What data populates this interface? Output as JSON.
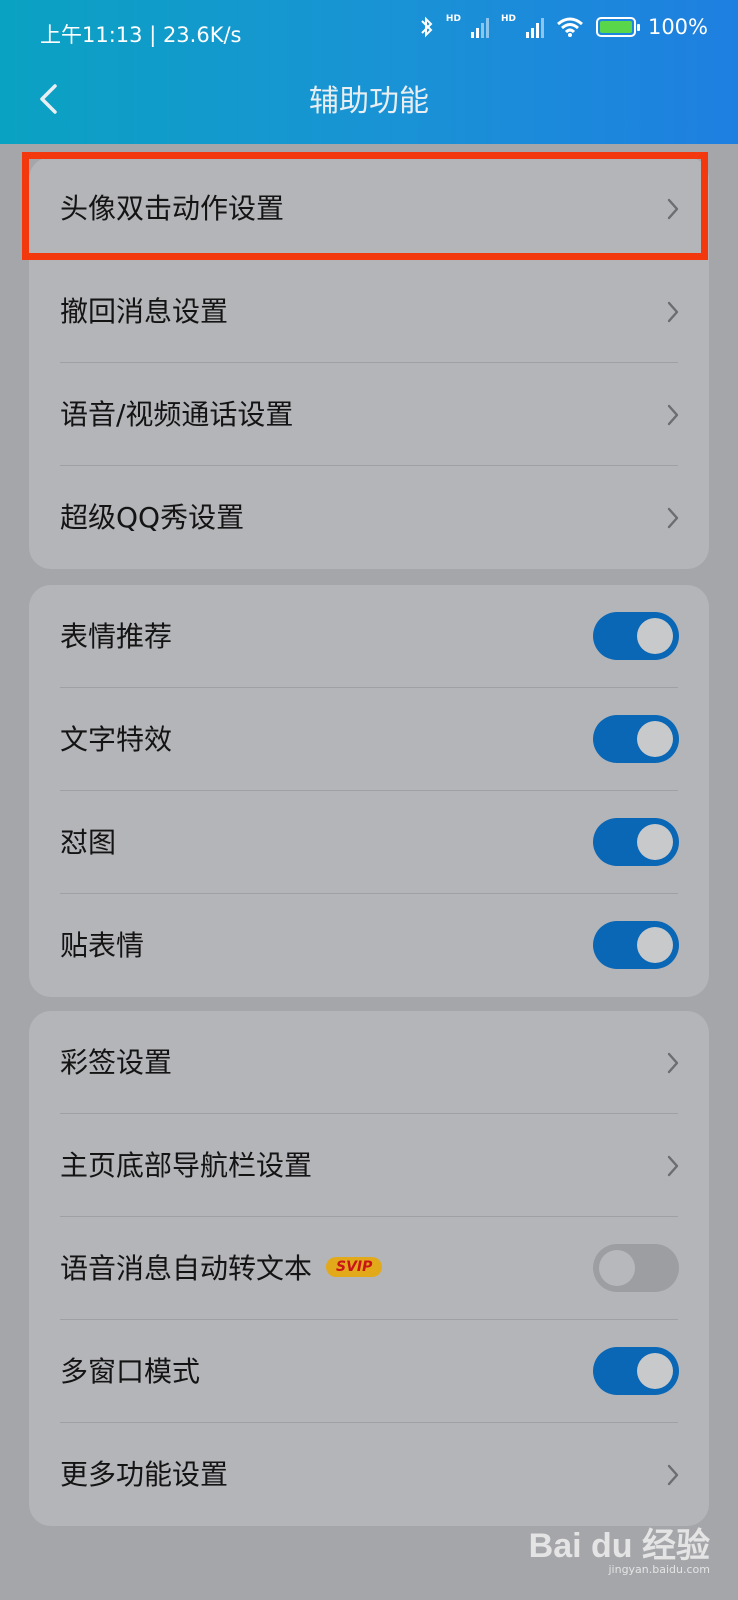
{
  "status_bar": {
    "time_and_speed": "上午11:13 | 23.6K/s",
    "hd_1": "HD",
    "hd_2": "HD",
    "battery": "100%",
    "battery_level": 1.0
  },
  "header": {
    "title": "辅助功能",
    "back_icon": "chevron-left-icon"
  },
  "group1": {
    "items": [
      {
        "label": "头像双击动作设置",
        "control": "chevron"
      },
      {
        "label": "撤回消息设置",
        "control": "chevron"
      },
      {
        "label": "语音/视频通话设置",
        "control": "chevron"
      },
      {
        "label": "超级QQ秀设置",
        "control": "chevron"
      }
    ]
  },
  "group2": {
    "items": [
      {
        "label": "表情推荐",
        "control": "toggle",
        "on": true
      },
      {
        "label": "文字特效",
        "control": "toggle",
        "on": true
      },
      {
        "label": "怼图",
        "control": "toggle",
        "on": true
      },
      {
        "label": "贴表情",
        "control": "toggle",
        "on": true
      }
    ]
  },
  "group3": {
    "items": [
      {
        "label": "彩签设置",
        "control": "chevron"
      },
      {
        "label": "主页底部导航栏设置",
        "control": "chevron"
      },
      {
        "label": "语音消息自动转文本",
        "control": "toggle",
        "on": false,
        "badge": "SVIP"
      },
      {
        "label": "多窗口模式",
        "control": "toggle",
        "on": true
      },
      {
        "label": "更多功能设置",
        "control": "chevron"
      }
    ]
  },
  "watermark": {
    "brand": "Bai du 经验",
    "url": "jingyan.baidu.com"
  },
  "colors": {
    "header_gradient_start": "#0aa2c2",
    "header_gradient_end": "#1e7fe0",
    "toggle_on": "#0a67b5",
    "highlight_border": "#f2380c",
    "svip_badge": "#e2a91a"
  }
}
